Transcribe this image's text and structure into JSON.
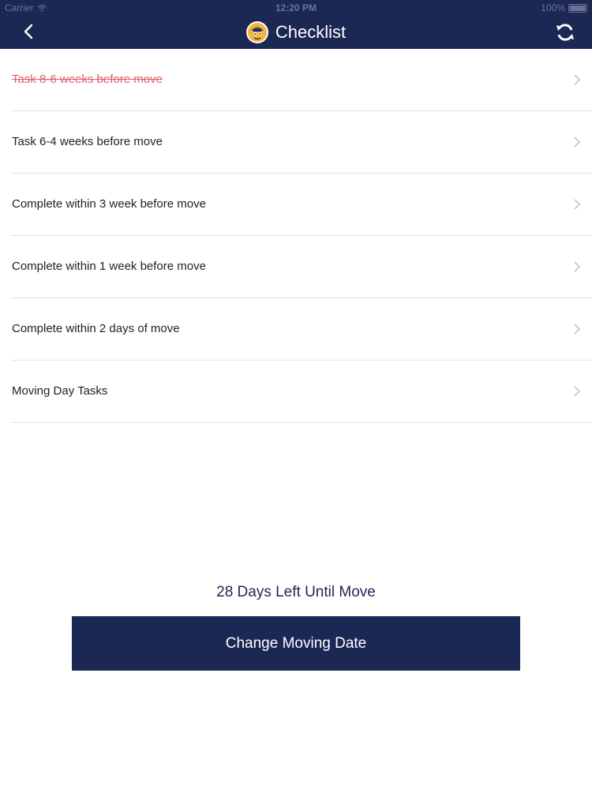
{
  "status_bar": {
    "carrier": "Carrier",
    "time": "12:20 PM",
    "battery": "100%"
  },
  "header": {
    "title": "Checklist",
    "back_icon": "chevron-left-icon",
    "refresh_icon": "refresh-icon",
    "background": "#1c2854"
  },
  "checklist": {
    "items": [
      {
        "label": "Task 8-6 weeks before move",
        "completed": true
      },
      {
        "label": "Task 6-4 weeks before move",
        "completed": false
      },
      {
        "label": "Complete within 3 week before move",
        "completed": false
      },
      {
        "label": "Complete within 1 week before move",
        "completed": false
      },
      {
        "label": "Complete within 2 days of move",
        "completed": false
      },
      {
        "label": "Moving Day Tasks",
        "completed": false
      }
    ]
  },
  "countdown": {
    "text": "28 Days Left Until Move"
  },
  "actions": {
    "change_date_label": "Change Moving Date"
  },
  "colors": {
    "brand": "#1c2854",
    "completed_text": "#e05d6a",
    "divider": "#e2e2e2"
  }
}
